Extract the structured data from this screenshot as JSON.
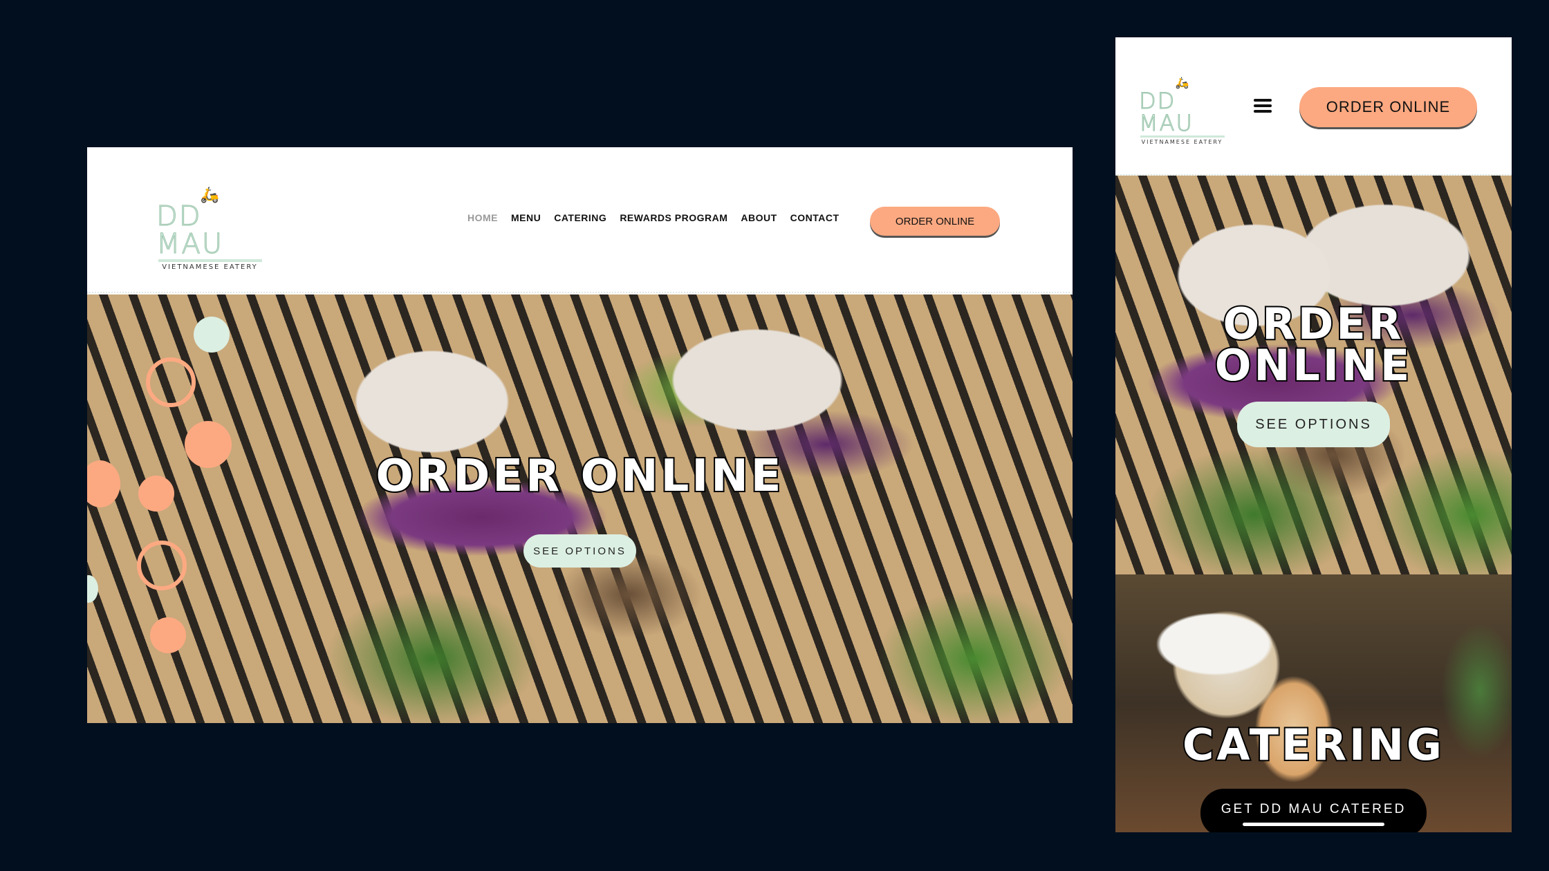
{
  "brand": {
    "name": "DD MAU",
    "tagline": "VIETNAMESE EATERY"
  },
  "desktop": {
    "nav": [
      {
        "label": "HOME",
        "active": true
      },
      {
        "label": "MENU"
      },
      {
        "label": "CATERING"
      },
      {
        "label": "REWARDS PROGRAM"
      },
      {
        "label": "ABOUT"
      },
      {
        "label": "CONTACT"
      }
    ],
    "order_button": "ORDER ONLINE",
    "hero": {
      "title": "ORDER ONLINE",
      "button": "SEE OPTIONS"
    }
  },
  "mobile": {
    "menu_icon": "hamburger-icon",
    "order_button": "ORDER ONLINE",
    "hero": {
      "title_line1": "ORDER",
      "title_line2": "ONLINE",
      "button": "SEE OPTIONS"
    },
    "catering": {
      "title": "CATERING",
      "button": "GET DD MAU CATERED"
    }
  },
  "colors": {
    "background": "#020f1f",
    "accent_orange": "#fca981",
    "accent_mint": "#dcefe3"
  }
}
